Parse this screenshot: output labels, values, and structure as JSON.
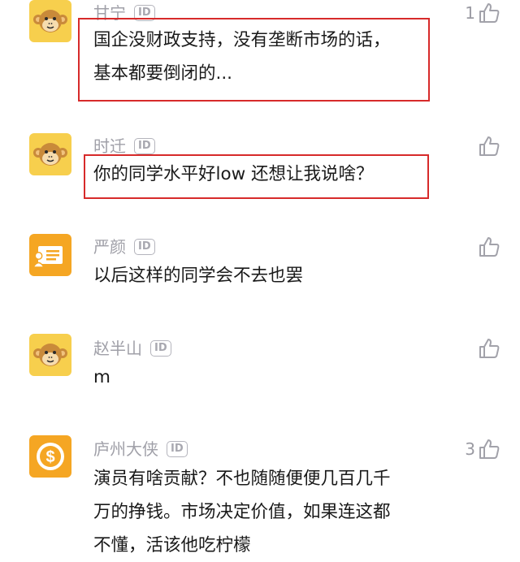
{
  "comments": [
    {
      "name": "甘宁",
      "id_badge": "ID",
      "lines": [
        "国企没财政支持，没有垄断市场的话，",
        "基本都要倒闭的..."
      ],
      "likes": "1",
      "avatar": "monkey-icon",
      "highlighted": true
    },
    {
      "name": "时迁",
      "id_badge": "ID",
      "lines": [
        "你的同学水平好low 还想让我说啥？"
      ],
      "likes": "",
      "avatar": "monkey-icon",
      "highlighted": true
    },
    {
      "name": "严颜",
      "id_badge": "ID",
      "lines": [
        "以后这样的同学会不去也罢"
      ],
      "likes": "",
      "avatar": "id-card-icon",
      "highlighted": false
    },
    {
      "name": "赵半山",
      "id_badge": "ID",
      "lines": [
        "m"
      ],
      "likes": "",
      "avatar": "monkey-icon",
      "highlighted": false
    },
    {
      "name": "庐州大侠",
      "id_badge": "ID",
      "lines": [
        "演员有啥贡献？不也随随便便几百几千",
        "万的挣钱。市场决定价值，如果连这都",
        "不懂，活该他吃柠檬"
      ],
      "likes": "3",
      "avatar": "dollar-coin-icon",
      "highlighted": false
    }
  ],
  "colors": {
    "highlight": "#d72a2a",
    "avatar_yellow": "#f7cf4d",
    "avatar_orange": "#f5a623",
    "name_gray": "#a0a0a8"
  }
}
